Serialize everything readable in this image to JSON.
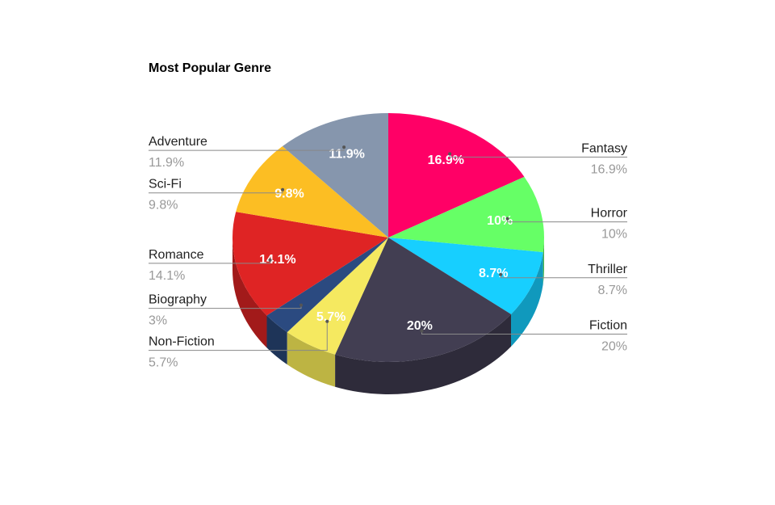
{
  "chart_data": {
    "type": "pie",
    "title": "Most Popular Genre",
    "slices": [
      {
        "name": "Fantasy",
        "value": 16.9,
        "pct_label": "16.9%",
        "inner_label": "16.9%",
        "color": "#ff0066",
        "side_color": "#b30048"
      },
      {
        "name": "Horror",
        "value": 10,
        "pct_label": "10%",
        "inner_label": "10%",
        "color": "#66ff66",
        "side_color": "#47b347"
      },
      {
        "name": "Thriller",
        "value": 8.7,
        "pct_label": "8.7%",
        "inner_label": "8.7%",
        "color": "#17cfff",
        "side_color": "#1099bd"
      },
      {
        "name": "Fiction",
        "value": 20,
        "pct_label": "20%",
        "inner_label": "20%",
        "color": "#423e52",
        "side_color": "#2e2b3a"
      },
      {
        "name": "Non-Fiction",
        "value": 5.7,
        "pct_label": "5.7%",
        "inner_label": "5.7%",
        "color": "#f5e960",
        "side_color": "#bdb443"
      },
      {
        "name": "Biography",
        "value": 3,
        "pct_label": "3%",
        "inner_label": "",
        "color": "#2b4a80",
        "side_color": "#1e3458"
      },
      {
        "name": "Romance",
        "value": 14.1,
        "pct_label": "14.1%",
        "inner_label": "14.1%",
        "color": "#df2424",
        "side_color": "#a21a1a"
      },
      {
        "name": "Sci-Fi",
        "value": 9.8,
        "pct_label": "9.8%",
        "inner_label": "9.8%",
        "color": "#fcbe23",
        "side_color": "#b88a18"
      },
      {
        "name": "Adventure",
        "value": 11.9,
        "pct_label": "11.9%",
        "inner_label": "11.9%",
        "color": "#8696ad",
        "side_color": "#5f6a7a"
      }
    ]
  }
}
